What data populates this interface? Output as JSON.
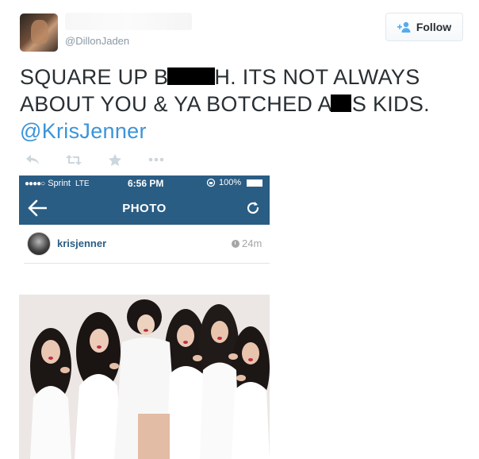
{
  "tweet": {
    "author_handle": "@DillonJaden",
    "follow_label": "Follow",
    "text_line1_before": "SQUARE UP B",
    "text_line1_after": "H. ITS NOT ALWAYS",
    "text_line2_before": "ABOUT YOU & YA BOTCHED A",
    "text_line2_after": "S KIDS.",
    "mention": "@KrisJenner",
    "actions": [
      {
        "icon": "reply-icon"
      },
      {
        "icon": "retweet-icon"
      },
      {
        "icon": "favorite-icon"
      },
      {
        "icon": "more-icon"
      }
    ]
  },
  "embedded_screenshot": {
    "status_bar": {
      "signal": "●●●●○",
      "carrier": "Sprint",
      "network": "LTE",
      "time": "6:56 PM",
      "battery": "100%"
    },
    "nav": {
      "title": "PHOTO"
    },
    "post": {
      "username": "krisjenner",
      "time_ago": "24m"
    }
  },
  "colors": {
    "ig_header": "#2a5d84",
    "mention": "#3b94d9",
    "handle": "#8899a6"
  }
}
